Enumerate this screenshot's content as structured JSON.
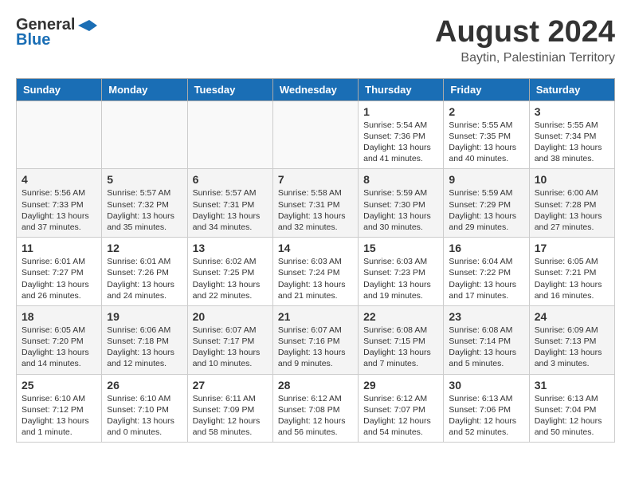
{
  "header": {
    "logo_line1": "General",
    "logo_line2": "Blue",
    "main_title": "August 2024",
    "subtitle": "Baytin, Palestinian Territory"
  },
  "days_of_week": [
    "Sunday",
    "Monday",
    "Tuesday",
    "Wednesday",
    "Thursday",
    "Friday",
    "Saturday"
  ],
  "weeks": [
    [
      {
        "day": "",
        "info": ""
      },
      {
        "day": "",
        "info": ""
      },
      {
        "day": "",
        "info": ""
      },
      {
        "day": "",
        "info": ""
      },
      {
        "day": "1",
        "info": "Sunrise: 5:54 AM\nSunset: 7:36 PM\nDaylight: 13 hours\nand 41 minutes."
      },
      {
        "day": "2",
        "info": "Sunrise: 5:55 AM\nSunset: 7:35 PM\nDaylight: 13 hours\nand 40 minutes."
      },
      {
        "day": "3",
        "info": "Sunrise: 5:55 AM\nSunset: 7:34 PM\nDaylight: 13 hours\nand 38 minutes."
      }
    ],
    [
      {
        "day": "4",
        "info": "Sunrise: 5:56 AM\nSunset: 7:33 PM\nDaylight: 13 hours\nand 37 minutes."
      },
      {
        "day": "5",
        "info": "Sunrise: 5:57 AM\nSunset: 7:32 PM\nDaylight: 13 hours\nand 35 minutes."
      },
      {
        "day": "6",
        "info": "Sunrise: 5:57 AM\nSunset: 7:31 PM\nDaylight: 13 hours\nand 34 minutes."
      },
      {
        "day": "7",
        "info": "Sunrise: 5:58 AM\nSunset: 7:31 PM\nDaylight: 13 hours\nand 32 minutes."
      },
      {
        "day": "8",
        "info": "Sunrise: 5:59 AM\nSunset: 7:30 PM\nDaylight: 13 hours\nand 30 minutes."
      },
      {
        "day": "9",
        "info": "Sunrise: 5:59 AM\nSunset: 7:29 PM\nDaylight: 13 hours\nand 29 minutes."
      },
      {
        "day": "10",
        "info": "Sunrise: 6:00 AM\nSunset: 7:28 PM\nDaylight: 13 hours\nand 27 minutes."
      }
    ],
    [
      {
        "day": "11",
        "info": "Sunrise: 6:01 AM\nSunset: 7:27 PM\nDaylight: 13 hours\nand 26 minutes."
      },
      {
        "day": "12",
        "info": "Sunrise: 6:01 AM\nSunset: 7:26 PM\nDaylight: 13 hours\nand 24 minutes."
      },
      {
        "day": "13",
        "info": "Sunrise: 6:02 AM\nSunset: 7:25 PM\nDaylight: 13 hours\nand 22 minutes."
      },
      {
        "day": "14",
        "info": "Sunrise: 6:03 AM\nSunset: 7:24 PM\nDaylight: 13 hours\nand 21 minutes."
      },
      {
        "day": "15",
        "info": "Sunrise: 6:03 AM\nSunset: 7:23 PM\nDaylight: 13 hours\nand 19 minutes."
      },
      {
        "day": "16",
        "info": "Sunrise: 6:04 AM\nSunset: 7:22 PM\nDaylight: 13 hours\nand 17 minutes."
      },
      {
        "day": "17",
        "info": "Sunrise: 6:05 AM\nSunset: 7:21 PM\nDaylight: 13 hours\nand 16 minutes."
      }
    ],
    [
      {
        "day": "18",
        "info": "Sunrise: 6:05 AM\nSunset: 7:20 PM\nDaylight: 13 hours\nand 14 minutes."
      },
      {
        "day": "19",
        "info": "Sunrise: 6:06 AM\nSunset: 7:18 PM\nDaylight: 13 hours\nand 12 minutes."
      },
      {
        "day": "20",
        "info": "Sunrise: 6:07 AM\nSunset: 7:17 PM\nDaylight: 13 hours\nand 10 minutes."
      },
      {
        "day": "21",
        "info": "Sunrise: 6:07 AM\nSunset: 7:16 PM\nDaylight: 13 hours\nand 9 minutes."
      },
      {
        "day": "22",
        "info": "Sunrise: 6:08 AM\nSunset: 7:15 PM\nDaylight: 13 hours\nand 7 minutes."
      },
      {
        "day": "23",
        "info": "Sunrise: 6:08 AM\nSunset: 7:14 PM\nDaylight: 13 hours\nand 5 minutes."
      },
      {
        "day": "24",
        "info": "Sunrise: 6:09 AM\nSunset: 7:13 PM\nDaylight: 13 hours\nand 3 minutes."
      }
    ],
    [
      {
        "day": "25",
        "info": "Sunrise: 6:10 AM\nSunset: 7:12 PM\nDaylight: 13 hours\nand 1 minute."
      },
      {
        "day": "26",
        "info": "Sunrise: 6:10 AM\nSunset: 7:10 PM\nDaylight: 13 hours\nand 0 minutes."
      },
      {
        "day": "27",
        "info": "Sunrise: 6:11 AM\nSunset: 7:09 PM\nDaylight: 12 hours\nand 58 minutes."
      },
      {
        "day": "28",
        "info": "Sunrise: 6:12 AM\nSunset: 7:08 PM\nDaylight: 12 hours\nand 56 minutes."
      },
      {
        "day": "29",
        "info": "Sunrise: 6:12 AM\nSunset: 7:07 PM\nDaylight: 12 hours\nand 54 minutes."
      },
      {
        "day": "30",
        "info": "Sunrise: 6:13 AM\nSunset: 7:06 PM\nDaylight: 12 hours\nand 52 minutes."
      },
      {
        "day": "31",
        "info": "Sunrise: 6:13 AM\nSunset: 7:04 PM\nDaylight: 12 hours\nand 50 minutes."
      }
    ]
  ]
}
